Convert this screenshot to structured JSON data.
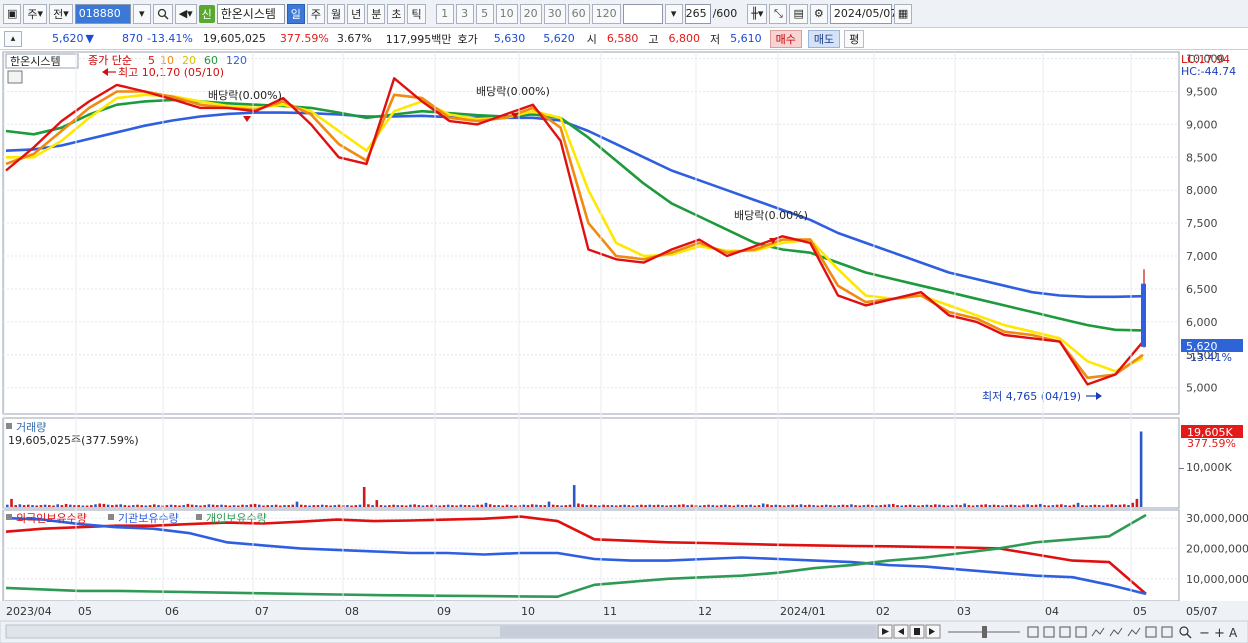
{
  "toolbar": {
    "market": "주",
    "market2": "전",
    "code": "018880",
    "name": "한온시스템",
    "sin_badge": "신",
    "periods": [
      "일",
      "주",
      "월",
      "년",
      "분",
      "초",
      "틱"
    ],
    "selected_period": "일",
    "intervals": [
      "1",
      "3",
      "5",
      "10",
      "20",
      "30",
      "60",
      "120"
    ],
    "count": "265",
    "count_max": "/600",
    "date": "2024/05/07"
  },
  "quote": {
    "price": "5,620",
    "change_arrow": "▼",
    "change": "870",
    "change_pct": "-13.41%",
    "volume": "19,605,025",
    "volume_pct": "377.59%",
    "turnover_pct": "3.67%",
    "amount": "117,995백만",
    "hoga_label": "호가",
    "ask": "5,630",
    "bid": "5,620",
    "open_label": "시",
    "open": "6,580",
    "high_label": "고",
    "high": "6,800",
    "low_label": "저",
    "low": "5,610",
    "buy_label": "매수",
    "sell_label": "매도",
    "avg_label": "평"
  },
  "colors": {
    "ma5": "#e01010",
    "ma10": "#f08a10",
    "ma20": "#ffe800",
    "ma60": "#1e9a3c",
    "ma120": "#2f5fe0",
    "volume_bar": "#2b58c6",
    "foreign": "#e01010",
    "institution": "#2f5fe0",
    "individual": "#2f9a55"
  },
  "chart_data": [
    {
      "type": "line",
      "title": "",
      "legend": {
        "stock": "한온시스템",
        "label": "종가 단순",
        "periods": [
          "5",
          "10",
          "20",
          "60",
          "120"
        ]
      },
      "y_ticks": [
        "10,000",
        "9,500",
        "9,000",
        "8,500",
        "8,000",
        "7,500",
        "7,000",
        "6,500",
        "6,000",
        "5,500",
        "5,000"
      ],
      "ylim": [
        4600,
        10100
      ],
      "x_ticks": [
        "2023/04",
        "05",
        "06",
        "07",
        "08",
        "09",
        "10",
        "11",
        "12",
        "2024/01",
        "02",
        "03",
        "04",
        "05",
        "05/07"
      ],
      "annotations": {
        "high": "최고 10,170 (05/10)",
        "low": "최저 4,765 (04/19)",
        "dividend1": "배당락(0.00%)",
        "dividend2": "배당락(0.00%)",
        "dividend3": "배당락(0.00%)",
        "lc": "LC:17.94",
        "hc": "HC:-44.74"
      },
      "last_price_label": "5,620",
      "last_pct_label": "-13.41%",
      "series": [
        {
          "name": "5",
          "values": [
            8300,
            8650,
            9050,
            9350,
            9600,
            9500,
            9380,
            9250,
            9250,
            9200,
            9400,
            9000,
            8500,
            8400,
            9700,
            9350,
            9050,
            9000,
            9150,
            9300,
            8750,
            7100,
            6950,
            6900,
            7100,
            7250,
            7000,
            7150,
            7300,
            7200,
            6400,
            6250,
            6350,
            6450,
            6100,
            6000,
            5800,
            5750,
            5700,
            5050,
            5200,
            5700
          ]
        },
        {
          "name": "10",
          "values": [
            8400,
            8550,
            8900,
            9250,
            9500,
            9500,
            9420,
            9300,
            9250,
            9220,
            9350,
            9150,
            8700,
            8450,
            9450,
            9400,
            9100,
            9050,
            9100,
            9250,
            8950,
            7500,
            7000,
            6950,
            7050,
            7200,
            7050,
            7100,
            7250,
            7250,
            6550,
            6300,
            6350,
            6400,
            6150,
            6050,
            5850,
            5800,
            5700,
            5150,
            5200,
            5500
          ]
        },
        {
          "name": "20",
          "values": [
            8500,
            8500,
            8750,
            9100,
            9400,
            9450,
            9430,
            9350,
            9280,
            9250,
            9300,
            9200,
            8900,
            8600,
            9200,
            9350,
            9150,
            9080,
            9100,
            9200,
            9100,
            8000,
            7200,
            7000,
            7020,
            7150,
            7080,
            7080,
            7200,
            7250,
            6800,
            6400,
            6350,
            6400,
            6250,
            6100,
            5950,
            5850,
            5750,
            5400,
            5250,
            5450
          ]
        },
        {
          "name": "60",
          "values": [
            8900,
            8850,
            8950,
            9150,
            9300,
            9350,
            9370,
            9350,
            9320,
            9300,
            9280,
            9250,
            9180,
            9100,
            9150,
            9200,
            9170,
            9140,
            9120,
            9150,
            9100,
            8800,
            8450,
            8100,
            7800,
            7600,
            7400,
            7200,
            7100,
            7050,
            6900,
            6750,
            6650,
            6550,
            6450,
            6350,
            6250,
            6150,
            6050,
            5950,
            5880,
            5870
          ]
        },
        {
          "name": "120",
          "values": [
            8600,
            8620,
            8680,
            8780,
            8880,
            8980,
            9060,
            9120,
            9160,
            9180,
            9180,
            9170,
            9150,
            9120,
            9120,
            9130,
            9110,
            9100,
            9100,
            9100,
            9060,
            8900,
            8700,
            8500,
            8300,
            8150,
            8000,
            7850,
            7700,
            7550,
            7350,
            7200,
            7050,
            6900,
            6750,
            6650,
            6550,
            6450,
            6400,
            6380,
            6380,
            6390
          ]
        }
      ]
    },
    {
      "type": "bar",
      "title": "거래량",
      "value_label": "19,605,025주(377.59%)",
      "axis_label": "10,000K",
      "last_label": "19,605K",
      "last_pct_label": "377.59%",
      "ylim": [
        0,
        20000
      ],
      "series": [
        {
          "name": "거래량",
          "values": [
            600,
            2100,
            500,
            700,
            500,
            600,
            500,
            400,
            500,
            600,
            500,
            400,
            700,
            500,
            800,
            600,
            500,
            500,
            400,
            400,
            500,
            700,
            900,
            800,
            600,
            500,
            600,
            700,
            500,
            400,
            500,
            600,
            500,
            400,
            500,
            700,
            500,
            400,
            500,
            600,
            500,
            400,
            500,
            800,
            600,
            500,
            400,
            500,
            700,
            600,
            500,
            600,
            500,
            400,
            500,
            400,
            600,
            500,
            700,
            800,
            600,
            400,
            500,
            500,
            600,
            400,
            500,
            500,
            600,
            1400,
            600,
            500,
            400,
            500,
            500,
            600,
            500,
            400,
            500,
            600,
            500,
            500,
            400,
            500,
            600,
            5200,
            700,
            500,
            1800,
            500,
            400,
            500,
            600,
            500,
            500,
            400,
            600,
            700,
            500,
            400,
            500,
            600,
            500,
            400,
            500,
            600,
            500,
            400,
            600,
            500,
            500,
            400,
            600,
            600,
            1100,
            700,
            500,
            500,
            400,
            600,
            500,
            400,
            500,
            600,
            500,
            700,
            600,
            500,
            500,
            1400,
            600,
            500,
            400,
            500,
            600,
            5700,
            900,
            700,
            500,
            600,
            500,
            400,
            600,
            500,
            500,
            400,
            500,
            600,
            500,
            400,
            500,
            600,
            500,
            600,
            500,
            600,
            500,
            400,
            500,
            500,
            600,
            700,
            500,
            600,
            500,
            400,
            500,
            600,
            500,
            400,
            500,
            600,
            500,
            400,
            600,
            500,
            500,
            600,
            400,
            500,
            900,
            700,
            500,
            600,
            500,
            400,
            500,
            600,
            500,
            700,
            500,
            600,
            500,
            400,
            500,
            600,
            500,
            400,
            500,
            600,
            500,
            700,
            500,
            400,
            500,
            600,
            500,
            400,
            500,
            600,
            700,
            800,
            500,
            400,
            500,
            600,
            500,
            400,
            500,
            600,
            500,
            700,
            600,
            500,
            400,
            500,
            600,
            500,
            900,
            500,
            400,
            500,
            600,
            700,
            500,
            600,
            500,
            400,
            500,
            600,
            500,
            400,
            600,
            700,
            500,
            600,
            800,
            500,
            400,
            500,
            600,
            700,
            500,
            400,
            600,
            1100,
            500,
            400,
            500,
            600,
            500,
            400,
            600,
            700,
            500,
            600,
            700,
            500,
            1100,
            2100,
            19605
          ]
        }
      ]
    },
    {
      "type": "line",
      "title": "",
      "legend": [
        "외국인보유수량",
        "기관보유수량",
        "개인보유수량"
      ],
      "y_ticks": [
        "30,000,000",
        "20,000,000",
        "10,000,000"
      ],
      "ylim": [
        3000000,
        32000000
      ],
      "series": [
        {
          "name": "외국인보유수량",
          "values": [
            25500000,
            26500000,
            27000000,
            27500000,
            27500000,
            28000000,
            28500000,
            28200000,
            28800000,
            29500000,
            29000000,
            29200000,
            29500000,
            29800000,
            30500000,
            29000000,
            23000000,
            22500000,
            22000000,
            21800000,
            21500000,
            21200000,
            21000000,
            20800000,
            20700000,
            20500000,
            20300000,
            20000000,
            18000000,
            16000000,
            15500000,
            5000000
          ]
        },
        {
          "name": "기관보유수량",
          "values": [
            30000000,
            29500000,
            28000000,
            27000000,
            26500000,
            25000000,
            22000000,
            21000000,
            20000000,
            19500000,
            19000000,
            18500000,
            18500000,
            18000000,
            18500000,
            18500000,
            16500000,
            16000000,
            16000000,
            16500000,
            17000000,
            16500000,
            16000000,
            15500000,
            14500000,
            14000000,
            13000000,
            12000000,
            11000000,
            10500000,
            8000000,
            5000000
          ]
        },
        {
          "name": "개인보유수량",
          "values": [
            7000000,
            6500000,
            6000000,
            6000000,
            5800000,
            5600000,
            5400000,
            5200000,
            5000000,
            4800000,
            4600000,
            4500000,
            4400000,
            4300000,
            4200000,
            4100000,
            8000000,
            9000000,
            10000000,
            10500000,
            11000000,
            12000000,
            13500000,
            14500000,
            16000000,
            17000000,
            18500000,
            20000000,
            22000000,
            23000000,
            24000000,
            31000000
          ]
        }
      ]
    }
  ],
  "footer": {
    "icons": [
      "zoom-in-icon",
      "zoom-out-icon",
      "plus-icon",
      "letter-a-icon"
    ],
    "plus_label": "+",
    "minus_label": "−",
    "a_label": "A"
  }
}
